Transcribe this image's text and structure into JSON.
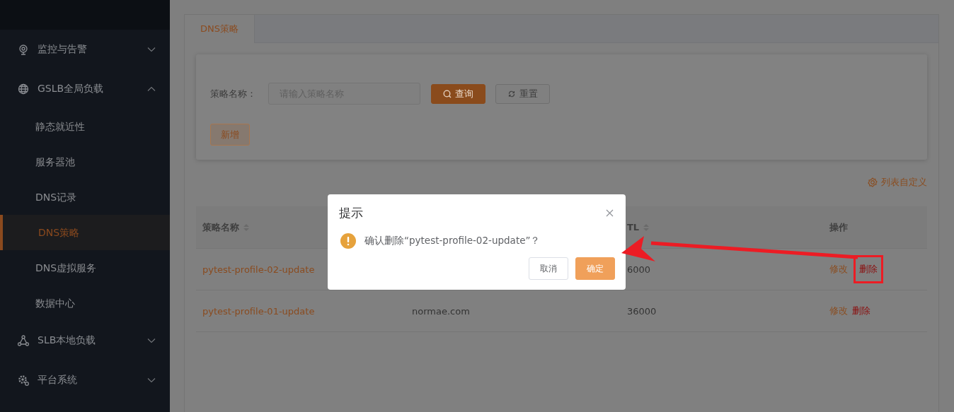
{
  "sidebar": {
    "items": [
      {
        "label": "监控与告警",
        "expanded": false
      },
      {
        "label": "GSLB全局负载",
        "expanded": true,
        "children": [
          {
            "label": "静态就近性",
            "selected": false
          },
          {
            "label": "服务器池",
            "selected": false
          },
          {
            "label": "DNS记录",
            "selected": false
          },
          {
            "label": "DNS策略",
            "selected": true
          },
          {
            "label": "DNS虚拟服务",
            "selected": false
          },
          {
            "label": "数据中心",
            "selected": false
          }
        ]
      },
      {
        "label": "SLB本地负载",
        "expanded": false
      },
      {
        "label": "平台系统",
        "expanded": false
      }
    ]
  },
  "tabs": [
    {
      "label": "DNS策略",
      "selected": true
    }
  ],
  "filter": {
    "label": "策略名称：",
    "placeholder": "请输入策略名称",
    "buttons": [
      {
        "label": "查询",
        "kind": "primary"
      },
      {
        "label": "重置",
        "kind": "default"
      }
    ],
    "add_button": "新增"
  },
  "column_settings": "列表自定义",
  "table": {
    "columns": [
      {
        "label": "策略名称",
        "sortable": true
      },
      {
        "label": "TL",
        "sortable": true
      },
      {
        "label": "操作",
        "sortable": false
      }
    ],
    "rows": [
      {
        "name": "pytest-profile-02-update",
        "ttl": "6000",
        "actions": [
          {
            "label": "修改",
            "kind": "edit",
            "annotated": false
          },
          {
            "label": "删除",
            "kind": "delete",
            "annotated": true
          }
        ]
      },
      {
        "name": "pytest-profile-01-update",
        "column_2": "normae.com",
        "ttl": "36000",
        "actions": [
          {
            "label": "修改",
            "kind": "edit",
            "annotated": false
          },
          {
            "label": "删除",
            "kind": "delete",
            "annotated": false
          }
        ]
      }
    ]
  },
  "dialog": {
    "title": "提示",
    "message": "确认删除“pytest-profile-02-update”？",
    "buttons": [
      {
        "label": "取消",
        "kind": "default"
      },
      {
        "label": "确定",
        "kind": "primary"
      }
    ]
  }
}
